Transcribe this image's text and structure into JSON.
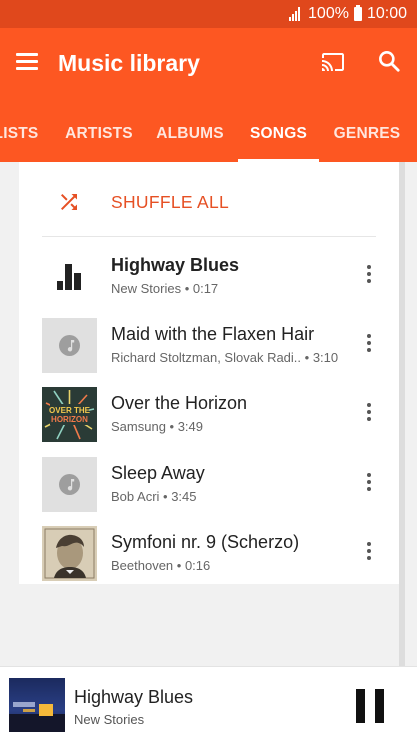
{
  "status": {
    "battery": "100%",
    "time": "10:00"
  },
  "app_bar": {
    "title": "Music library"
  },
  "tabs": [
    {
      "label": "LISTS"
    },
    {
      "label": "ARTISTS"
    },
    {
      "label": "ALBUMS"
    },
    {
      "label": "SONGS",
      "active": true
    },
    {
      "label": "GENRES"
    }
  ],
  "shuffle": {
    "label": "SHUFFLE ALL"
  },
  "songs": [
    {
      "title": "Highway Blues",
      "artist": "New Stories",
      "duration": "0:17",
      "now_playing": true
    },
    {
      "title": "Maid with the Flaxen Hair",
      "artist": "Richard Stoltzman, Slovak Radi..",
      "duration": "3:10"
    },
    {
      "title": "Over the Horizon",
      "artist": "Samsung",
      "duration": "3:49",
      "art_text": [
        "OVER THE",
        "HORIZON"
      ]
    },
    {
      "title": "Sleep Away",
      "artist": "Bob Acri",
      "duration": "3:45"
    },
    {
      "title": "Symfoni nr. 9 (Scherzo)",
      "artist": "Beethoven",
      "duration": "0:16"
    }
  ],
  "player": {
    "title": "Highway Blues",
    "artist": "New Stories"
  },
  "colors": {
    "status": "#e0481c",
    "app_bar": "#fd5722",
    "accent": "#e65024"
  },
  "icons": [
    "signal-icon",
    "battery-icon",
    "menu-icon",
    "cast-icon",
    "search-icon",
    "shuffle-icon",
    "equalizer-icon",
    "music-note-icon",
    "more-vert-icon",
    "pause-icon"
  ]
}
